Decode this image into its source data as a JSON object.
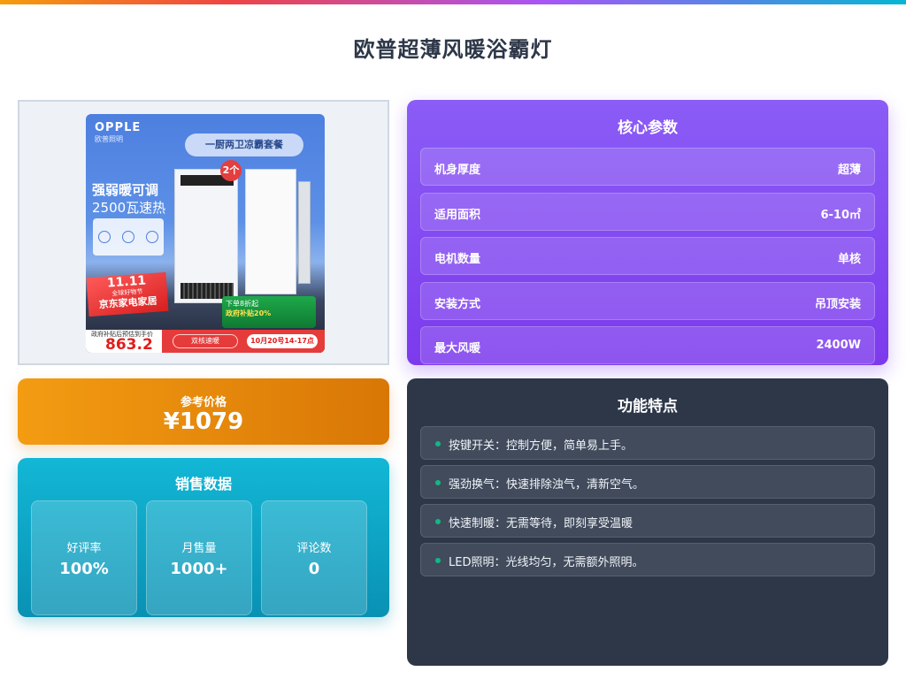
{
  "page": {
    "title": "欧普超薄风暖浴霸灯"
  },
  "product_image": {
    "brand": "OPPLE",
    "brand_sub": "欧普照明",
    "pill_text": "一厨两卫凉霸套餐",
    "badge": "2个",
    "feature_line1": "强弱暖可调",
    "feature_line2": "2500瓦速热",
    "sale_date": "11.11",
    "sale_sub": "全球好物节",
    "sale_mall": "京东家电家居",
    "subsidy_line1": "下单8折起",
    "subsidy_line2": "政府补贴20%",
    "price_label": "政府补贴后预估到手价",
    "price_value": "863.2",
    "btn_quick": "双核速暖",
    "btn_date": "10月20号14-17点"
  },
  "price": {
    "label": "参考价格",
    "value": "¥1079"
  },
  "sales": {
    "title": "销售数据",
    "stats": [
      {
        "label": "好评率",
        "value": "100%"
      },
      {
        "label": "月售量",
        "value": "1000+"
      },
      {
        "label": "评论数",
        "value": "0"
      }
    ]
  },
  "params": {
    "title": "核心参数",
    "rows": [
      {
        "label": "机身厚度",
        "value": "超薄"
      },
      {
        "label": "适用面积",
        "value": "6-10㎡"
      },
      {
        "label": "电机数量",
        "value": "单核"
      },
      {
        "label": "安装方式",
        "value": "吊顶安装"
      },
      {
        "label": "最大风暖",
        "value": "2400W"
      }
    ]
  },
  "features": {
    "title": "功能特点",
    "items": [
      "按键开关：控制方便，简单易上手。",
      "强劲换气：快速排除浊气，清新空气。",
      "快速制暖：无需等待，即刻享受温暖",
      "LED照明：光线均匀，无需额外照明。"
    ]
  }
}
